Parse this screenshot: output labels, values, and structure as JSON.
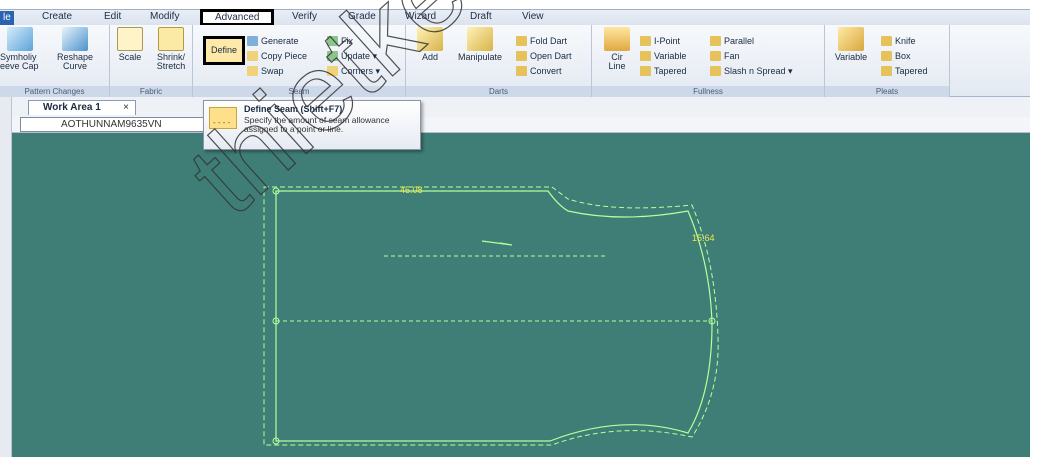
{
  "menu": {
    "tabs": [
      "le",
      "Create",
      "Edit",
      "Modify",
      "Advanced",
      "Verify",
      "Grade",
      "Wizard",
      "Draft",
      "View"
    ]
  },
  "ribbon": {
    "groups": {
      "pattern_changes": {
        "label": "Pattern Changes",
        "buttons": [
          "Symholiy\neeve Cap",
          "Reshape\nCurve"
        ]
      },
      "fabric": {
        "label": "Fabric",
        "buttons": [
          "Scale",
          "Shrink/\nStretch"
        ]
      },
      "seam": {
        "label": "Seam",
        "define": "Define",
        "small": [
          "Generate",
          "Copy Piece",
          "Swap",
          "Fix",
          "Update ▾",
          "Corners ▾"
        ]
      },
      "darts": {
        "label": "Darts",
        "buttons": [
          "Add",
          "Manipulate"
        ],
        "small": [
          "Fold Dart",
          "Open Dart",
          "Convert"
        ]
      },
      "fullness": {
        "label": "Fullness",
        "button": "Cir\nLine",
        "small": [
          "I-Point",
          "Variable",
          "Tapered",
          "Parallel",
          "Fan",
          "Slash n Spread ▾"
        ]
      },
      "pleats": {
        "label": "Pleats",
        "button": "Variable",
        "small": [
          "Knife",
          "Box",
          "Tapered"
        ]
      }
    }
  },
  "worktab": {
    "label": "Work Area 1",
    "close": "×"
  },
  "piece": {
    "name": "AOTHUNNAM9635VN"
  },
  "tooltip": {
    "title": "Define Seam (Shift+F7)",
    "desc": "Specify the amount of seam allowance assigned to a point or line.",
    "icon_dash": "- - - -"
  },
  "pattern": {
    "top_measure": "45.08",
    "right_measure": "15.64"
  },
  "watermark": "thietkei",
  "colors": {
    "canvas": "#3e7e76",
    "pattern_line": "#b6ff9a",
    "measure_text": "#f1e94a",
    "highlight_border": "#000000",
    "file_tab": "#2a63b0"
  }
}
